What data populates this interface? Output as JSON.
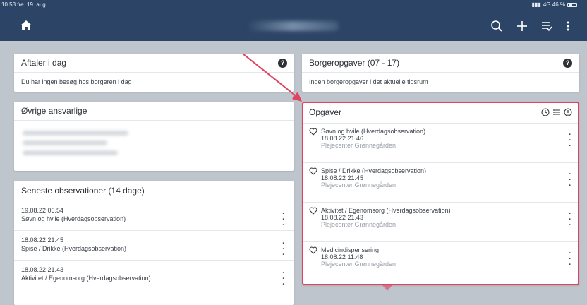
{
  "status": {
    "time_date": "10.53  fre. 19. aug.",
    "network": "4G 46 %"
  },
  "header": {
    "icons": [
      "home-icon",
      "search-icon",
      "plus-icon",
      "checklist-icon",
      "more-vertical-icon"
    ]
  },
  "aftaler": {
    "title": "Aftaler i dag",
    "body": "Du har ingen besøg hos borgeren i dag"
  },
  "borgeropgaver": {
    "title": "Borgeropgaver (07 - 17)",
    "body": "Ingen borgeropgaver i det aktuelle tidsrum"
  },
  "ansvarlige": {
    "title": "Øvrige ansvarlige"
  },
  "observationer": {
    "title": "Seneste observationer (14 dage)",
    "rows": [
      {
        "date": "19.08.22 06.54",
        "name": "Søvn og hvile (Hverdagsobservation)"
      },
      {
        "date": "18.08.22 21.45",
        "name": "Spise / Drikke (Hverdagsobservation)"
      },
      {
        "date": "18.08.22 21.43",
        "name": "Aktivitet / Egenomsorg (Hverdagsobservation)"
      }
    ]
  },
  "opgaver": {
    "title": "Opgaver",
    "tasks": [
      {
        "name": "Søvn og hvile (Hverdagsobservation)",
        "time": "18.08.22 21.46",
        "place": "Plejecenter Grønnegården"
      },
      {
        "name": "Spise / Drikke (Hverdagsobservation)",
        "time": "18.08.22 21.45",
        "place": "Plejecenter Grønnegården"
      },
      {
        "name": "Aktivitet / Egenomsorg (Hverdagsobservation)",
        "time": "18.08.22 21.43",
        "place": "Plejecenter Grønnegården"
      },
      {
        "name": "Medicindispensering",
        "time": "18.08.22 11.48",
        "place": "Plejecenter Grønnegården"
      }
    ]
  },
  "colors": {
    "header": "#2c4566",
    "highlight": "#e0425f"
  }
}
